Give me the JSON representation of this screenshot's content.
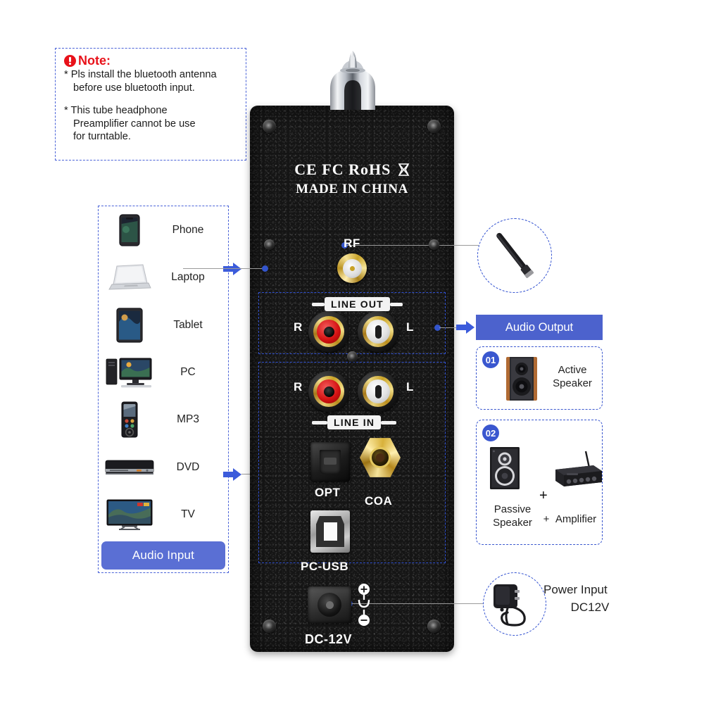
{
  "note": {
    "title": "Note:",
    "icon": "exclamation-icon",
    "line1a": "* Pls install the bluetooth antenna",
    "line1b": "before use bluetooth input.",
    "line2a": "* This tube headphone",
    "line2b": "Preamplifier cannot be use",
    "line2c": "for turntable."
  },
  "audio_input": {
    "button_label": "Audio Input",
    "devices": [
      {
        "label": "Phone",
        "icon": "smartphone-icon"
      },
      {
        "label": "Laptop",
        "icon": "laptop-icon"
      },
      {
        "label": "Tablet",
        "icon": "tablet-icon"
      },
      {
        "label": "PC",
        "icon": "desktop-computer-icon"
      },
      {
        "label": "MP3",
        "icon": "mp3-player-icon"
      },
      {
        "label": "DVD",
        "icon": "dvd-player-icon"
      },
      {
        "label": "TV",
        "icon": "television-icon"
      }
    ]
  },
  "device": {
    "certifications": "CE FC RoHS",
    "origin": "MADE IN CHINA",
    "rf_label": "RF",
    "line_out_label": "LINE OUT",
    "line_in_label": "LINE IN",
    "channel_right": "R",
    "channel_left": "L",
    "opt_label": "OPT",
    "coa_label": "COA",
    "usb_label": "PC-USB",
    "dc_label": "DC-12V"
  },
  "audio_output": {
    "button_label": "Audio Output",
    "cards": [
      {
        "badge": "01",
        "label_line1": "Active",
        "label_line2": "Speaker",
        "icon": "active-speaker-icon"
      },
      {
        "badge": "02",
        "label_line1": "Passive",
        "label_line2": "Speaker",
        "plus": "+",
        "label_line3": "Amplifier",
        "icon_a": "passive-speaker-icon",
        "icon_b": "amplifier-icon",
        "plus_mid": "+"
      }
    ]
  },
  "antenna": {
    "icon": "bluetooth-antenna-icon"
  },
  "power": {
    "icon": "power-adapter-icon",
    "line1": "Power Input",
    "line2": "DC12V"
  },
  "colors": {
    "accent_blue": "#3a57cf",
    "button_blue": "#4c62cd",
    "input_button_blue": "#5a6fd4",
    "note_red": "#e8121a",
    "panel_black": "#151515"
  }
}
